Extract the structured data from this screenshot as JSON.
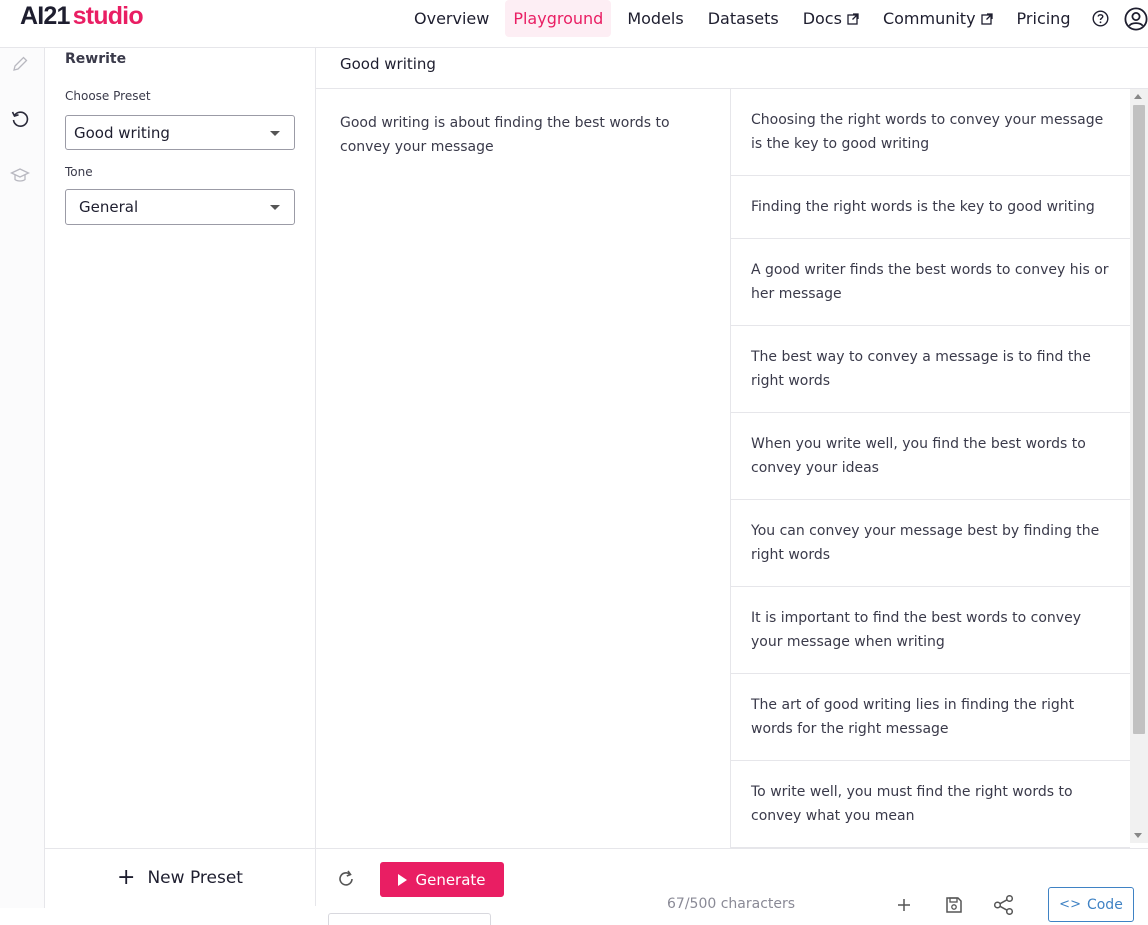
{
  "app": {
    "logo_ai": "AI21",
    "logo_studio": "studio"
  },
  "nav": {
    "items": [
      {
        "label": "Overview",
        "active": false,
        "external": false
      },
      {
        "label": "Playground",
        "active": true,
        "external": false
      },
      {
        "label": "Models",
        "active": false,
        "external": false
      },
      {
        "label": "Datasets",
        "active": false,
        "external": false
      },
      {
        "label": "Docs",
        "active": false,
        "external": true
      },
      {
        "label": "Community",
        "active": false,
        "external": true
      },
      {
        "label": "Pricing",
        "active": false,
        "external": false
      }
    ],
    "icons": [
      "help-icon",
      "account-icon"
    ]
  },
  "rail": {
    "icons": [
      "pencil-icon",
      "rewrite-icon",
      "graduation-cap-icon"
    ]
  },
  "panel": {
    "title": "Rewrite",
    "preset_label": "Choose Preset",
    "preset_value": "Good writing",
    "tone_label": "Tone",
    "tone_value": "General",
    "new_preset_label": "New Preset"
  },
  "main": {
    "title": "Good writing",
    "input_text": "Good writing is about finding the best words to convey your message",
    "results": [
      "Choosing the right words to convey your message is the key to good writing",
      "Finding the right words is the key to good writing",
      "A good writer finds the best words to convey his or her message",
      "The best way to convey a message is to find the right words",
      "When you write well, you find the best words to convey your ideas",
      "You can convey your message best by finding the right words",
      "It is important to find the best words to convey your message when writing",
      "The art of good writing lies in finding the right words for the right message",
      "To write well, you must find the right words to convey what you mean"
    ]
  },
  "bottom": {
    "generate_label": "Generate",
    "char_count": "67/500 characters",
    "code_label": "Code"
  },
  "colors": {
    "accent": "#e91e63",
    "link": "#3f82c4"
  }
}
